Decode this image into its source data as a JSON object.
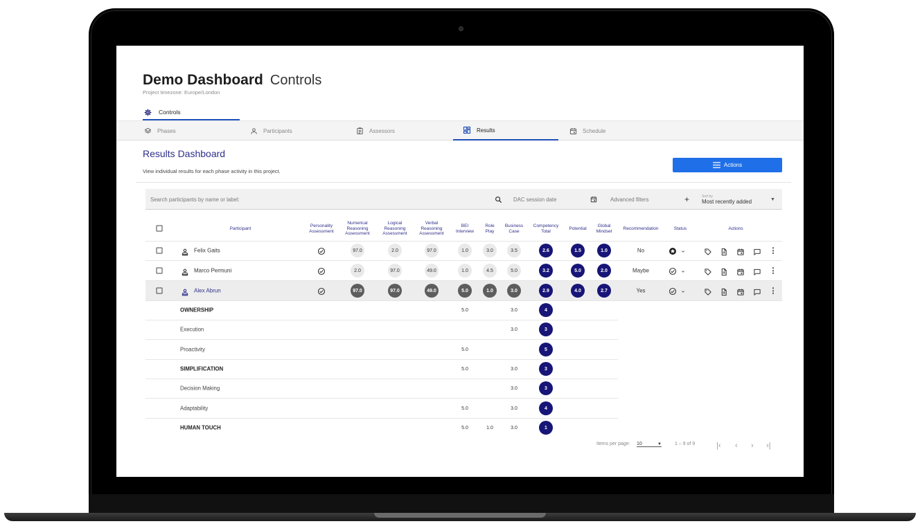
{
  "header": {
    "title": "Demo Dashboard",
    "subtitle": "Controls",
    "timezone": "Project timezone: Europe/London"
  },
  "controls_tab": {
    "label": "Controls",
    "icon": "gear-icon"
  },
  "nav": [
    {
      "label": "Phases",
      "icon": "layers-icon"
    },
    {
      "label": "Participants",
      "icon": "person-icon"
    },
    {
      "label": "Assessors",
      "icon": "clipboard-icon"
    },
    {
      "label": "Results",
      "icon": "dashboard-icon",
      "active": true
    },
    {
      "label": "Schedule",
      "icon": "calendar-icon"
    }
  ],
  "results": {
    "title": "Results Dashboard",
    "description": "View individual results for each phase activity in this project.",
    "actions_label": "Actions"
  },
  "filters": {
    "search_placeholder": "Search participants by name or label:",
    "session_date_placeholder": "DAC session date",
    "advanced_filters": "Advanced filters",
    "sort_label": "Sort by",
    "sort_value": "Most recently added"
  },
  "columns": {
    "participant": "Participant",
    "personality": [
      "Personality",
      "Assessment"
    ],
    "numerical": [
      "Numerical",
      "Reasoning",
      "Assessment"
    ],
    "logical": [
      "Logical",
      "Reasoning",
      "Assessment"
    ],
    "verbal": [
      "Verbal",
      "Reasoning",
      "Assessment"
    ],
    "bei": [
      "BEI",
      "Interview"
    ],
    "role_play": [
      "Role",
      "Play"
    ],
    "business_case": [
      "Business",
      "Case"
    ],
    "competency_total": [
      "Competency",
      "Total"
    ],
    "potential": "Potential",
    "global_mindset": [
      "Global",
      "Mindset"
    ],
    "recommendation": "Recommendation",
    "status": "Status",
    "actions": "Actions"
  },
  "participants": [
    {
      "name": "Felix Gaits",
      "numerical": "97.0",
      "logical": "2.0",
      "verbal": "97.0",
      "bei": "1.0",
      "role_play": "3.0",
      "business_case": "3.5",
      "competency_total": "2.6",
      "potential": "1.5",
      "global_mindset": "1.0",
      "recommendation": "No",
      "status": "star-badge-icon"
    },
    {
      "name": "Marco Permuni",
      "numerical": "2.0",
      "logical": "97.0",
      "verbal": "49.0",
      "bei": "1.0",
      "role_play": "4.5",
      "business_case": "5.0",
      "competency_total": "3.2",
      "potential": "5.0",
      "global_mindset": "2.0",
      "recommendation": "Maybe",
      "status": "check-circle-icon"
    },
    {
      "name": "Alex Abrun",
      "numerical": "97.0",
      "logical": "97.0",
      "verbal": "49.0",
      "bei": "5.0",
      "role_play": "1.0",
      "business_case": "3.0",
      "competency_total": "2.9",
      "potential": "4.0",
      "global_mindset": "2.7",
      "recommendation": "Yes",
      "status": "check-circle-icon",
      "expanded": true
    }
  ],
  "competencies": [
    {
      "name": "OWNERSHIP",
      "group": true,
      "bei": "5.0",
      "role_play": "",
      "business_case": "3.0",
      "total": "4"
    },
    {
      "name": "Execution",
      "group": false,
      "bei": "",
      "role_play": "",
      "business_case": "3.0",
      "total": "3"
    },
    {
      "name": "Proactivity",
      "group": false,
      "bei": "5.0",
      "role_play": "",
      "business_case": "",
      "total": "5"
    },
    {
      "name": "SIMPLIFICATION",
      "group": true,
      "bei": "5.0",
      "role_play": "",
      "business_case": "3.0",
      "total": "3"
    },
    {
      "name": "Decision Making",
      "group": false,
      "bei": "",
      "role_play": "",
      "business_case": "3.0",
      "total": "3"
    },
    {
      "name": "Adaptability",
      "group": false,
      "bei": "5.0",
      "role_play": "",
      "business_case": "3.0",
      "total": "4"
    },
    {
      "name": "HUMAN TOUCH",
      "group": true,
      "bei": "5.0",
      "role_play": "1.0",
      "business_case": "3.0",
      "total": "1"
    }
  ],
  "pagination": {
    "items_per_page_label": "Items per page:",
    "items_per_page": "10",
    "range": "1 – 9 of 9"
  },
  "colors": {
    "primary": "#1f6fe8",
    "navy": "#171577",
    "heading": "#2f2f8a"
  }
}
